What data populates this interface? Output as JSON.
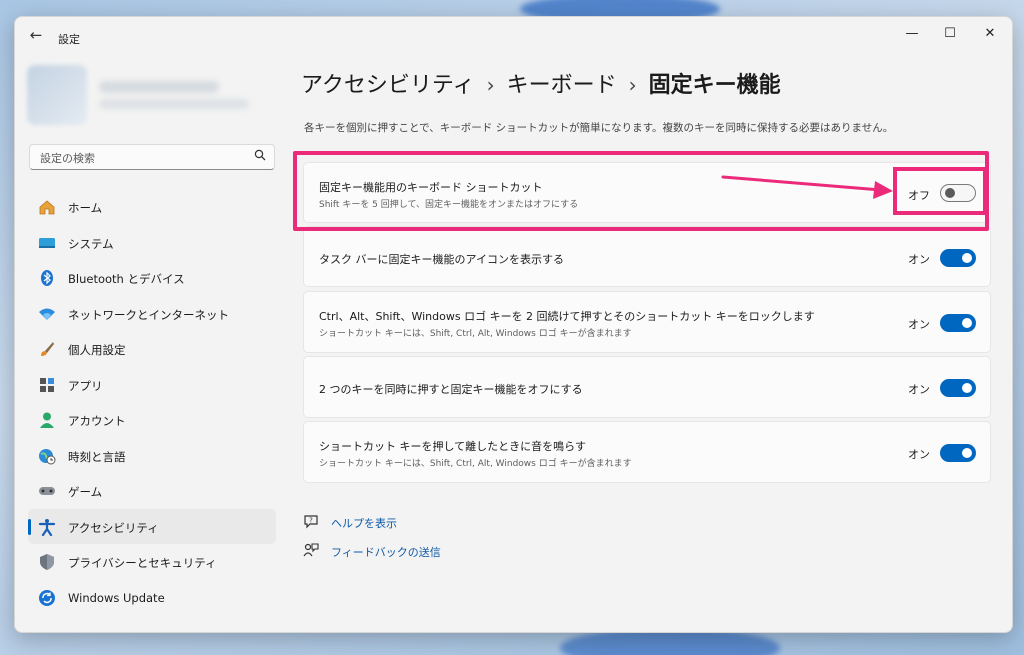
{
  "window": {
    "title": "設定",
    "back_glyph": "←",
    "min_glyph": "—",
    "max_glyph": "☐",
    "close_glyph": "✕"
  },
  "search": {
    "placeholder": "設定の検索"
  },
  "sidebar": {
    "items": [
      {
        "label": "ホーム",
        "icon": "home-icon",
        "active": false
      },
      {
        "label": "システム",
        "icon": "system-icon",
        "active": false
      },
      {
        "label": "Bluetooth とデバイス",
        "icon": "bluetooth-icon",
        "active": false
      },
      {
        "label": "ネットワークとインターネット",
        "icon": "network-icon",
        "active": false
      },
      {
        "label": "個人用設定",
        "icon": "personalization-icon",
        "active": false
      },
      {
        "label": "アプリ",
        "icon": "apps-icon",
        "active": false
      },
      {
        "label": "アカウント",
        "icon": "account-icon",
        "active": false
      },
      {
        "label": "時刻と言語",
        "icon": "time-language-icon",
        "active": false
      },
      {
        "label": "ゲーム",
        "icon": "gaming-icon",
        "active": false
      },
      {
        "label": "アクセシビリティ",
        "icon": "accessibility-icon",
        "active": true
      },
      {
        "label": "プライバシーとセキュリティ",
        "icon": "privacy-icon",
        "active": false
      },
      {
        "label": "Windows Update",
        "icon": "windows-update-icon",
        "active": false
      }
    ]
  },
  "breadcrumb": {
    "level1": "アクセシビリティ",
    "level2": "キーボード",
    "current": "固定キー機能",
    "separator": "›"
  },
  "description": "各キーを個別に押すことで、キーボード ショートカットが簡単になります。複数のキーを同時に保持する必要はありません。",
  "settings": [
    {
      "title": "固定キー機能用のキーボード ショートカット",
      "subtitle": "Shift キーを 5 回押して、固定キー機能をオンまたはオフにする",
      "state": "オフ",
      "on": false
    },
    {
      "title": "タスク バーに固定キー機能のアイコンを表示する",
      "subtitle": "",
      "state": "オン",
      "on": true
    },
    {
      "title": "Ctrl、Alt、Shift、Windows ロゴ キーを 2 回続けて押すとそのショートカット キーをロックします",
      "subtitle": "ショートカット キーには、Shift, Ctrl, Alt, Windows ロゴ キーが含まれます",
      "state": "オン",
      "on": true
    },
    {
      "title": "2 つのキーを同時に押すと固定キー機能をオフにする",
      "subtitle": "",
      "state": "オン",
      "on": true
    },
    {
      "title": "ショートカット キーを押して離したときに音を鳴らす",
      "subtitle": "ショートカット キーには、Shift, Ctrl, Alt, Windows ロゴ キーが含まれます",
      "state": "オン",
      "on": true
    }
  ],
  "links": {
    "help": "ヘルプを表示",
    "feedback": "フィードバックの送信"
  },
  "colors": {
    "accent": "#0067c0",
    "highlight": "#ec2a7a",
    "link": "#0f5aa8"
  }
}
